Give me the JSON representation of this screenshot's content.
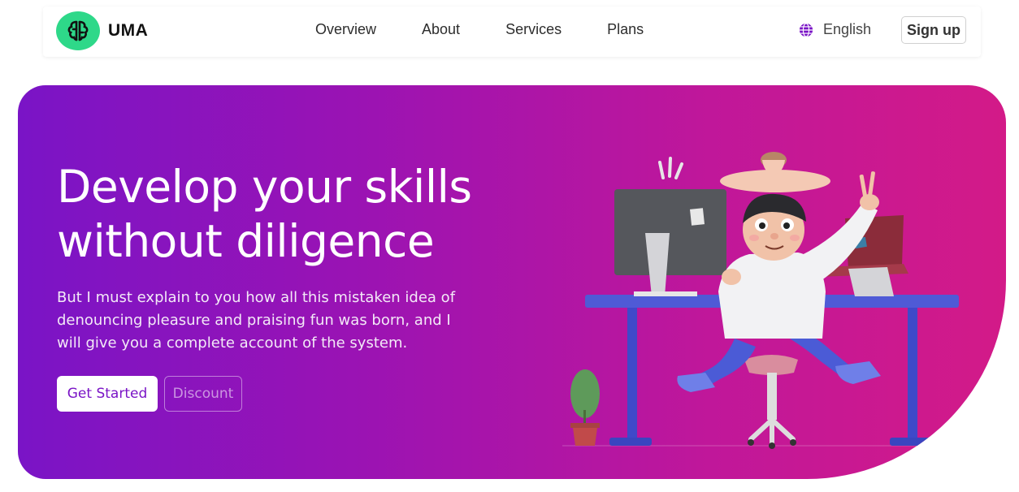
{
  "brand": {
    "name": "UMA",
    "logo_icon": "brain-icon",
    "logo_color": "#2ed889"
  },
  "nav": {
    "links": [
      {
        "label": "Overview"
      },
      {
        "label": "About"
      },
      {
        "label": "Services"
      },
      {
        "label": "Plans"
      }
    ],
    "language": {
      "label": "English",
      "icon": "globe-icon",
      "icon_color": "#7a14c6"
    },
    "signup_label": "Sign up"
  },
  "hero": {
    "title": "Develop your skills without diligence",
    "description": "But I must explain to you how all this mistaken idea of denouncing pleasure and praising fun was born, and I will give you a complete account of the system.",
    "primary_button": "Get Started",
    "secondary_button": "Discount",
    "gradient_start": "#7a14c6",
    "gradient_end": "#d31a88",
    "illustration": "person-at-desk-illustration"
  }
}
